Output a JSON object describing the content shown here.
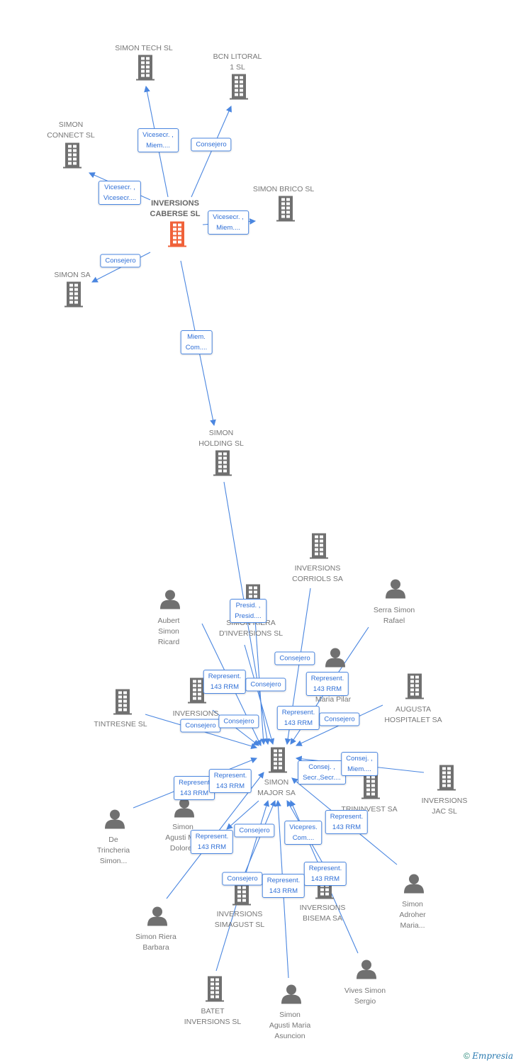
{
  "colors": {
    "edge": "#4a86e0",
    "node": "#707070",
    "focus_node": "#f0623a"
  },
  "nodes": [
    {
      "label": "SIMON TECH SL",
      "type": "company"
    },
    {
      "label": "BCN LITORAL\n1 SL",
      "type": "company"
    },
    {
      "label": "SIMON\nCONNECT SL",
      "type": "company"
    },
    {
      "label": "INVERSIONS\nCABERSE SL",
      "type": "company",
      "focus": true
    },
    {
      "label": "SIMON BRICO SL",
      "type": "company"
    },
    {
      "label": "SIMON SA",
      "type": "company"
    },
    {
      "label": "SIMON\nHOLDING SL",
      "type": "company"
    },
    {
      "label": "SIMON\nMAJOR SA",
      "type": "company"
    },
    {
      "label": "INVERSIONS\nCORRIOLS SA",
      "type": "company"
    },
    {
      "label": "SIMON RIERA\nD'INVERSIONS SL",
      "type": "company"
    },
    {
      "label": "Serra Simon\nRafael",
      "type": "person"
    },
    {
      "label": "Aubert\nSimon\nRicard",
      "type": "person"
    },
    {
      "label": "Maria Pilar",
      "type": "person"
    },
    {
      "label": "INVERSIONS",
      "type": "company"
    },
    {
      "label": "TINTRESNE SL",
      "type": "company"
    },
    {
      "label": "AUGUSTA\nHOSPITALET SA",
      "type": "company"
    },
    {
      "label": "INVERSIONS\nJAC SL",
      "type": "company"
    },
    {
      "label": "TRININVEST SA",
      "type": "company"
    },
    {
      "label": "De\nTrincheria\nSimon...",
      "type": "person"
    },
    {
      "label": "Simon\nAgusti M...\nDolores",
      "type": "person"
    },
    {
      "label": "Simon Riera\nBarbara",
      "type": "person"
    },
    {
      "label": "INVERSIONS\nSIMAGUST SL",
      "type": "company"
    },
    {
      "label": "INVERSIONS\nBISEMA SA",
      "type": "company"
    },
    {
      "label": "Simon\nAdroher\nMaria...",
      "type": "person"
    },
    {
      "label": "Vives Simon\nSergio",
      "type": "person"
    },
    {
      "label": "BATET\nINVERSIONS SL",
      "type": "company"
    },
    {
      "label": "Simon\nAgusti Maria\nAsuncion",
      "type": "person"
    }
  ],
  "edge_labels": [
    "Vicesecr. ,\nMiem....",
    "Consejero",
    "Vicesecr. ,\nVicesecr....",
    "Vicesecr. ,\nMiem....",
    "Consejero",
    "Miem.\nCom....",
    "Presid. ,\nPresid....",
    "Consejero",
    "Represent.\n143 RRM",
    "Consejero",
    "Represent.\n143 RRM",
    "Represent.\n143 RRM",
    "Consejero",
    "Consejero",
    "Consejero",
    "Represent\n143 RRM",
    "Represent.\n143 RRM",
    "Consej. ,\nSecr.,Secr....",
    "Consej. ,\nMiem....",
    "Consejero",
    "Represent.\n143 RRM",
    "Vicepres.\nCom....",
    "Represent.\n143 RRM",
    "Represent.\n143 RRM",
    "Consejero",
    "Represent.\n143 RRM"
  ],
  "footer": {
    "copyright": "©",
    "brand": "Empresia"
  }
}
